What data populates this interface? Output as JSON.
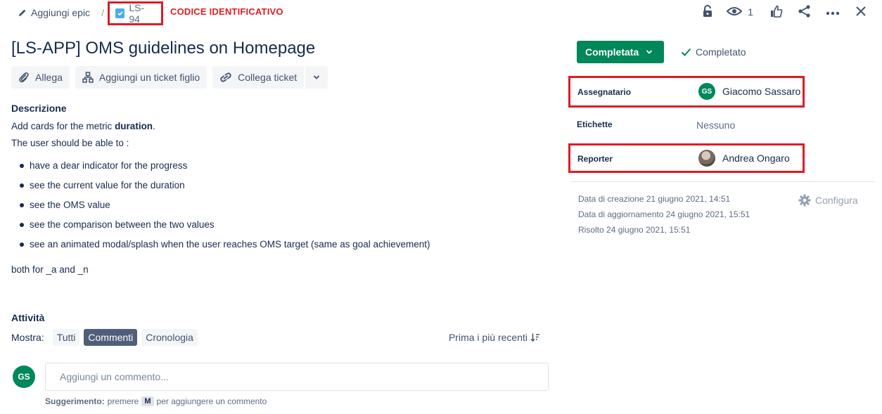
{
  "breadcrumb": {
    "epic_label": "Aggiungi epic",
    "separator": "/",
    "issue_key": "LS-94",
    "annotation": "CODICE IDENTIFICATIVO"
  },
  "toolbar": {
    "watchers_count": "1"
  },
  "issue": {
    "title": "[LS-APP] OMS guidelines on Homepage",
    "actions": {
      "attach": "Allega",
      "add_child": "Aggiungi un ticket figlio",
      "link": "Collega ticket"
    }
  },
  "description": {
    "label": "Descrizione",
    "line1_pre": "Add cards for the metric ",
    "line1_bold": "duration",
    "line1_post": ".",
    "line2": "The user should be able to :",
    "bullets": [
      "have a dear indicator for the progress",
      "see the current value for the duration",
      "see the OMS value",
      "see the comparison between the two values",
      "see an animated modal/splash when the user reaches OMS target (same as goal achievement)"
    ],
    "footer": "both for _a and _n"
  },
  "activity": {
    "label": "Attività",
    "show_label": "Mostra:",
    "filters": [
      "Tutti",
      "Commenti",
      "Cronologia"
    ],
    "sort_label": "Prima i più recenti",
    "user_initials": "GS",
    "comment_placeholder": "Aggiungi un commento...",
    "hint_bold": "Suggerimento:",
    "hint_pre": "premere",
    "hint_key": "M",
    "hint_post": "per aggiungere un commento"
  },
  "status": {
    "button_label": "Completata",
    "resolution": "Completato"
  },
  "fields": {
    "assignee_label": "Assegnatario",
    "assignee_initials": "GS",
    "assignee_name": "Giacomo Sassaro",
    "labels_label": "Etichette",
    "labels_value": "Nessuno",
    "reporter_label": "Reporter",
    "reporter_name": "Andrea Ongaro"
  },
  "meta": {
    "created": "Data di creazione 21 giugno 2021, 14:51",
    "updated": "Data di aggiornamento 24 giugno 2021, 15:51",
    "resolved": "Risolto 24 giugno 2021, 15:51",
    "configure": "Configura"
  },
  "colors": {
    "accent_green": "#00875a",
    "highlight_red": "#e01b24",
    "active_filter": "#505f79"
  }
}
